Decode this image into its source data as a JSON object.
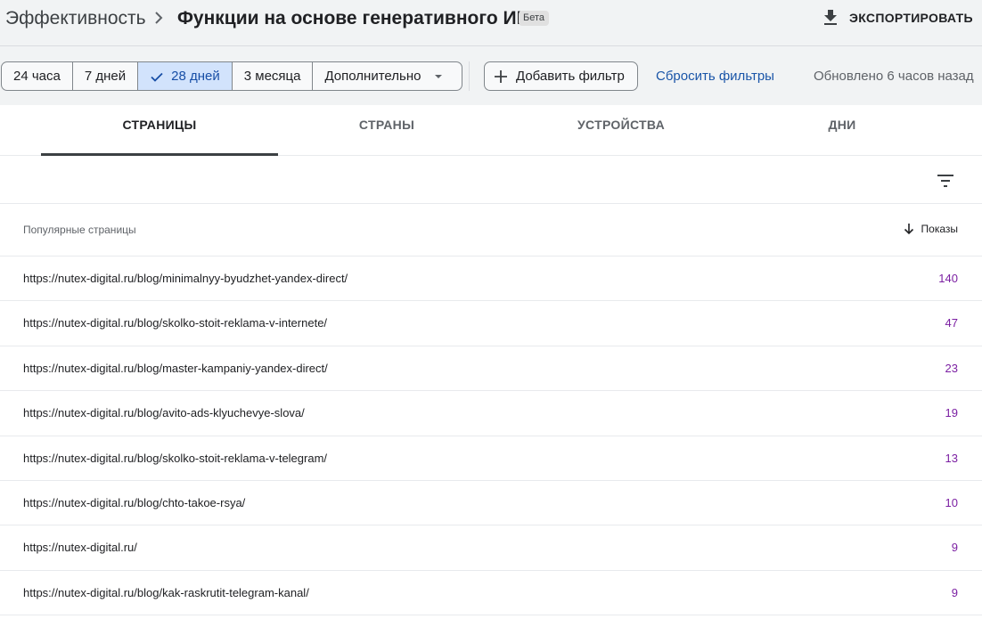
{
  "header": {
    "breadcrumb_root": "Эффективность",
    "title": "Функции на основе генеративного ИИ",
    "badge": "Бета",
    "export_label": "ЭКСПОРТИРОВАТЬ"
  },
  "filters": {
    "ranges": [
      {
        "label": "24 часа",
        "selected": false
      },
      {
        "label": "7 дней",
        "selected": false
      },
      {
        "label": "28 дней",
        "selected": true
      },
      {
        "label": "3 месяца",
        "selected": false
      }
    ],
    "more_label": "Дополнительно",
    "add_filter_label": "Добавить фильтр",
    "reset_label": "Сбросить фильтры",
    "updated_text": "Обновлено 6 часов назад"
  },
  "tabs": [
    {
      "label": "СТРАНИЦЫ",
      "active": true
    },
    {
      "label": "СТРАНЫ",
      "active": false
    },
    {
      "label": "УСТРОЙСТВА",
      "active": false
    },
    {
      "label": "ДНИ",
      "active": false
    }
  ],
  "table": {
    "col_left": "Популярные страницы",
    "col_right": "Показы",
    "rows": [
      {
        "url": "https://nutex-digital.ru/blog/minimalnyy-byudzhet-yandex-direct/",
        "value": "140"
      },
      {
        "url": "https://nutex-digital.ru/blog/skolko-stoit-reklama-v-internete/",
        "value": "47"
      },
      {
        "url": "https://nutex-digital.ru/blog/master-kampaniy-yandex-direct/",
        "value": "23"
      },
      {
        "url": "https://nutex-digital.ru/blog/avito-ads-klyuchevye-slova/",
        "value": "19"
      },
      {
        "url": "https://nutex-digital.ru/blog/skolko-stoit-reklama-v-telegram/",
        "value": "13"
      },
      {
        "url": "https://nutex-digital.ru/blog/chto-takoe-rsya/",
        "value": "10"
      },
      {
        "url": "https://nutex-digital.ru/",
        "value": "9"
      },
      {
        "url": "https://nutex-digital.ru/blog/kak-raskrutit-telegram-kanal/",
        "value": "9"
      }
    ]
  },
  "colors": {
    "accent_blue": "#1a55a8",
    "selected_bg": "#d2e3fc",
    "value_purple": "#7b1fa2"
  }
}
